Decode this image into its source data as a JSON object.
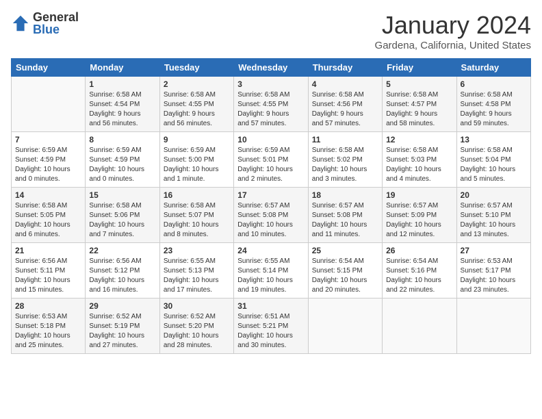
{
  "logo": {
    "general": "General",
    "blue": "Blue"
  },
  "title": {
    "month_year": "January 2024",
    "location": "Gardena, California, United States"
  },
  "days_header": [
    "Sunday",
    "Monday",
    "Tuesday",
    "Wednesday",
    "Thursday",
    "Friday",
    "Saturday"
  ],
  "weeks": [
    [
      {
        "day": "",
        "info": ""
      },
      {
        "day": "1",
        "info": "Sunrise: 6:58 AM\nSunset: 4:54 PM\nDaylight: 9 hours\nand 56 minutes."
      },
      {
        "day": "2",
        "info": "Sunrise: 6:58 AM\nSunset: 4:55 PM\nDaylight: 9 hours\nand 56 minutes."
      },
      {
        "day": "3",
        "info": "Sunrise: 6:58 AM\nSunset: 4:55 PM\nDaylight: 9 hours\nand 57 minutes."
      },
      {
        "day": "4",
        "info": "Sunrise: 6:58 AM\nSunset: 4:56 PM\nDaylight: 9 hours\nand 57 minutes."
      },
      {
        "day": "5",
        "info": "Sunrise: 6:58 AM\nSunset: 4:57 PM\nDaylight: 9 hours\nand 58 minutes."
      },
      {
        "day": "6",
        "info": "Sunrise: 6:58 AM\nSunset: 4:58 PM\nDaylight: 9 hours\nand 59 minutes."
      }
    ],
    [
      {
        "day": "7",
        "info": "Sunrise: 6:59 AM\nSunset: 4:59 PM\nDaylight: 10 hours\nand 0 minutes."
      },
      {
        "day": "8",
        "info": "Sunrise: 6:59 AM\nSunset: 4:59 PM\nDaylight: 10 hours\nand 0 minutes."
      },
      {
        "day": "9",
        "info": "Sunrise: 6:59 AM\nSunset: 5:00 PM\nDaylight: 10 hours\nand 1 minute."
      },
      {
        "day": "10",
        "info": "Sunrise: 6:59 AM\nSunset: 5:01 PM\nDaylight: 10 hours\nand 2 minutes."
      },
      {
        "day": "11",
        "info": "Sunrise: 6:58 AM\nSunset: 5:02 PM\nDaylight: 10 hours\nand 3 minutes."
      },
      {
        "day": "12",
        "info": "Sunrise: 6:58 AM\nSunset: 5:03 PM\nDaylight: 10 hours\nand 4 minutes."
      },
      {
        "day": "13",
        "info": "Sunrise: 6:58 AM\nSunset: 5:04 PM\nDaylight: 10 hours\nand 5 minutes."
      }
    ],
    [
      {
        "day": "14",
        "info": "Sunrise: 6:58 AM\nSunset: 5:05 PM\nDaylight: 10 hours\nand 6 minutes."
      },
      {
        "day": "15",
        "info": "Sunrise: 6:58 AM\nSunset: 5:06 PM\nDaylight: 10 hours\nand 7 minutes."
      },
      {
        "day": "16",
        "info": "Sunrise: 6:58 AM\nSunset: 5:07 PM\nDaylight: 10 hours\nand 8 minutes."
      },
      {
        "day": "17",
        "info": "Sunrise: 6:57 AM\nSunset: 5:08 PM\nDaylight: 10 hours\nand 10 minutes."
      },
      {
        "day": "18",
        "info": "Sunrise: 6:57 AM\nSunset: 5:08 PM\nDaylight: 10 hours\nand 11 minutes."
      },
      {
        "day": "19",
        "info": "Sunrise: 6:57 AM\nSunset: 5:09 PM\nDaylight: 10 hours\nand 12 minutes."
      },
      {
        "day": "20",
        "info": "Sunrise: 6:57 AM\nSunset: 5:10 PM\nDaylight: 10 hours\nand 13 minutes."
      }
    ],
    [
      {
        "day": "21",
        "info": "Sunrise: 6:56 AM\nSunset: 5:11 PM\nDaylight: 10 hours\nand 15 minutes."
      },
      {
        "day": "22",
        "info": "Sunrise: 6:56 AM\nSunset: 5:12 PM\nDaylight: 10 hours\nand 16 minutes."
      },
      {
        "day": "23",
        "info": "Sunrise: 6:55 AM\nSunset: 5:13 PM\nDaylight: 10 hours\nand 17 minutes."
      },
      {
        "day": "24",
        "info": "Sunrise: 6:55 AM\nSunset: 5:14 PM\nDaylight: 10 hours\nand 19 minutes."
      },
      {
        "day": "25",
        "info": "Sunrise: 6:54 AM\nSunset: 5:15 PM\nDaylight: 10 hours\nand 20 minutes."
      },
      {
        "day": "26",
        "info": "Sunrise: 6:54 AM\nSunset: 5:16 PM\nDaylight: 10 hours\nand 22 minutes."
      },
      {
        "day": "27",
        "info": "Sunrise: 6:53 AM\nSunset: 5:17 PM\nDaylight: 10 hours\nand 23 minutes."
      }
    ],
    [
      {
        "day": "28",
        "info": "Sunrise: 6:53 AM\nSunset: 5:18 PM\nDaylight: 10 hours\nand 25 minutes."
      },
      {
        "day": "29",
        "info": "Sunrise: 6:52 AM\nSunset: 5:19 PM\nDaylight: 10 hours\nand 27 minutes."
      },
      {
        "day": "30",
        "info": "Sunrise: 6:52 AM\nSunset: 5:20 PM\nDaylight: 10 hours\nand 28 minutes."
      },
      {
        "day": "31",
        "info": "Sunrise: 6:51 AM\nSunset: 5:21 PM\nDaylight: 10 hours\nand 30 minutes."
      },
      {
        "day": "",
        "info": ""
      },
      {
        "day": "",
        "info": ""
      },
      {
        "day": "",
        "info": ""
      }
    ]
  ]
}
